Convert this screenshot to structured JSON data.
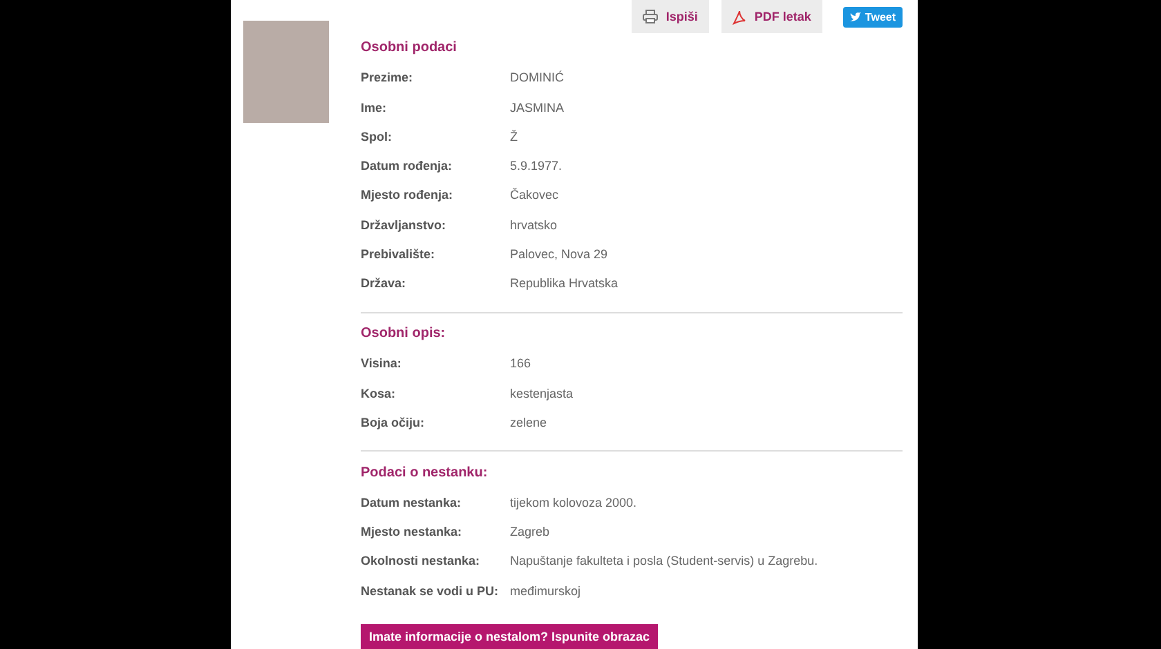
{
  "actions": [
    {
      "kind": "print",
      "label": "Ispiši"
    },
    {
      "kind": "pdf",
      "label": "PDF letak"
    },
    {
      "kind": "tweet",
      "label": "Tweet"
    }
  ],
  "sections": [
    {
      "title": "Osobni podaci",
      "rows": [
        {
          "label": "Prezime:",
          "value": "DOMINIĆ"
        },
        {
          "label": "Ime:",
          "value": "JASMINA"
        },
        {
          "label": "Spol:",
          "value": "Ž"
        },
        {
          "label": "Datum rođenja:",
          "value": "5.9.1977."
        },
        {
          "label": "Mjesto rođenja:",
          "value": "Čakovec"
        },
        {
          "label": "Državljanstvo:",
          "value": "hrvatsko"
        },
        {
          "label": "Prebivalište:",
          "value": "Palovec, Nova 29"
        },
        {
          "label": "Država:",
          "value": "Republika Hrvatska"
        }
      ]
    },
    {
      "title": "Osobni opis:",
      "rows": [
        {
          "label": "Visina:",
          "value": "166"
        },
        {
          "label": "Kosa:",
          "value": "kestenjasta"
        },
        {
          "label": "Boja očiju:",
          "value": "zelene"
        }
      ]
    },
    {
      "title": "Podaci o nestanku:",
      "rows": [
        {
          "label": "Datum nestanka:",
          "value": "tijekom kolovoza 2000."
        },
        {
          "label": "Mjesto nestanka:",
          "value": "Zagreb"
        },
        {
          "label": "Okolnosti nestanka:",
          "value": "Napuštanje fakulteta i posla (Student-servis) u Zagrebu."
        },
        {
          "label": "Nestanak se vodi u PU:",
          "value": "međimurskoj"
        }
      ]
    }
  ],
  "report_button": "Imate informacije o nestalom? Ispunite obrazac"
}
